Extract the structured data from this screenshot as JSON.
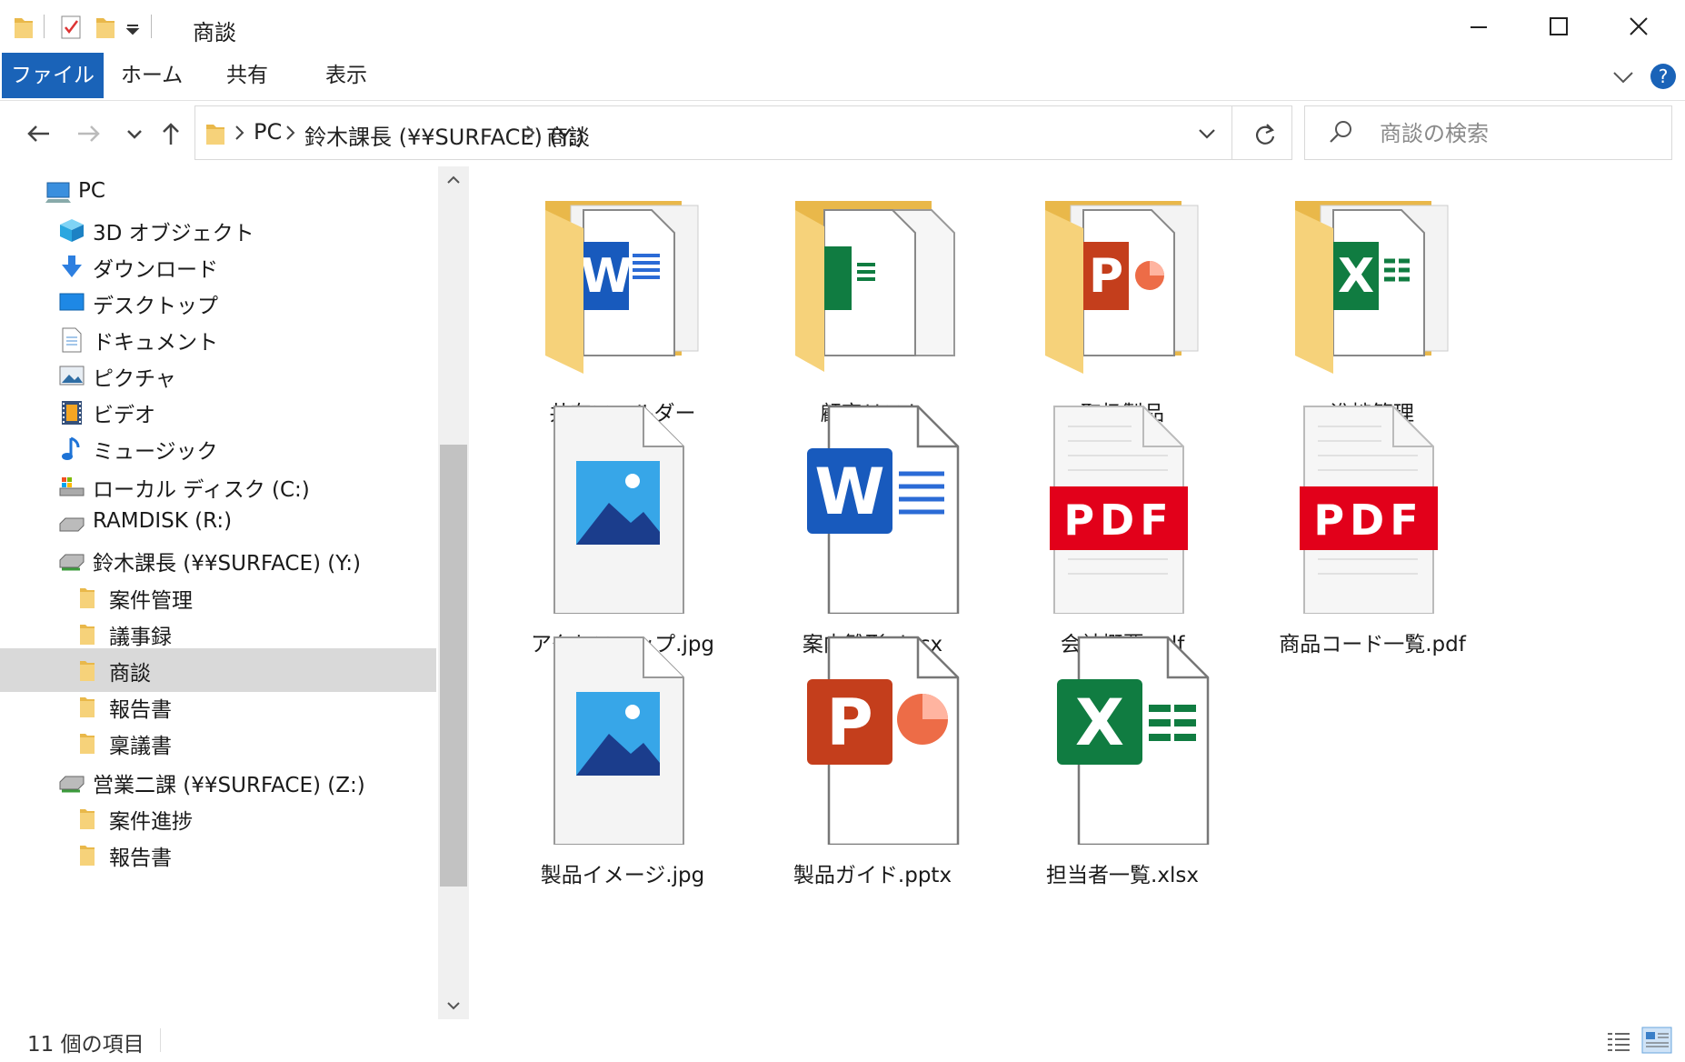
{
  "window": {
    "title": "商談",
    "accent": "#1a63b8"
  },
  "ribbon": {
    "tabs": [
      "ファイル",
      "ホーム",
      "共有",
      "表示"
    ]
  },
  "address": {
    "crumbs": [
      "PC",
      "鈴木課長 (¥¥SURFACE) (Y:)",
      "商談"
    ]
  },
  "search": {
    "placeholder": "商談の検索"
  },
  "nav": {
    "items": [
      {
        "label": "PC",
        "icon": "pc-icon"
      },
      {
        "label": "3D オブジェクト",
        "icon": "3d-objects-icon"
      },
      {
        "label": "ダウンロード",
        "icon": "download-icon"
      },
      {
        "label": "デスクトップ",
        "icon": "desktop-icon"
      },
      {
        "label": "ドキュメント",
        "icon": "documents-icon"
      },
      {
        "label": "ピクチャ",
        "icon": "pictures-icon"
      },
      {
        "label": "ビデオ",
        "icon": "videos-icon"
      },
      {
        "label": "ミュージック",
        "icon": "music-icon"
      },
      {
        "label": "ローカル ディスク (C:)",
        "icon": "local-disk-icon"
      },
      {
        "label": "RAMDISK (R:)",
        "icon": "drive-icon"
      },
      {
        "label": "鈴木課長 (¥¥SURFACE) (Y:)",
        "icon": "network-drive-icon"
      },
      {
        "label": "案件管理",
        "icon": "folder-icon"
      },
      {
        "label": "議事録",
        "icon": "folder-icon"
      },
      {
        "label": "商談",
        "icon": "folder-icon"
      },
      {
        "label": "報告書",
        "icon": "folder-icon"
      },
      {
        "label": "稟議書",
        "icon": "folder-icon"
      },
      {
        "label": "営業二課 (¥¥SURFACE) (Z:)",
        "icon": "network-drive-icon"
      },
      {
        "label": "案件進捗",
        "icon": "folder-icon"
      },
      {
        "label": "報告書",
        "icon": "folder-icon"
      }
    ],
    "selected": "商談"
  },
  "files": [
    {
      "name": "共有フォルダー",
      "type": "folder-word"
    },
    {
      "name": "顧客リスト",
      "type": "folder-excel-stack"
    },
    {
      "name": "取扱製品",
      "type": "folder-powerpoint"
    },
    {
      "name": "進捗管理",
      "type": "folder-excel"
    },
    {
      "name": "アクセスマップ.jpg",
      "type": "image"
    },
    {
      "name": "案内雛形.docx",
      "type": "word"
    },
    {
      "name": "会社概要.pdf",
      "type": "pdf"
    },
    {
      "name": "商品コード一覧.pdf",
      "type": "pdf"
    },
    {
      "name": "製品イメージ.jpg",
      "type": "image"
    },
    {
      "name": "製品ガイド.pptx",
      "type": "powerpoint"
    },
    {
      "name": "担当者一覧.xlsx",
      "type": "excel"
    }
  ],
  "status": {
    "item_count": "11 個の項目"
  },
  "colors": {
    "word": "#185abd",
    "excel": "#107c41",
    "powerpoint": "#c43e1c",
    "pdf": "#e2001a",
    "folder": "#f6d27a"
  }
}
